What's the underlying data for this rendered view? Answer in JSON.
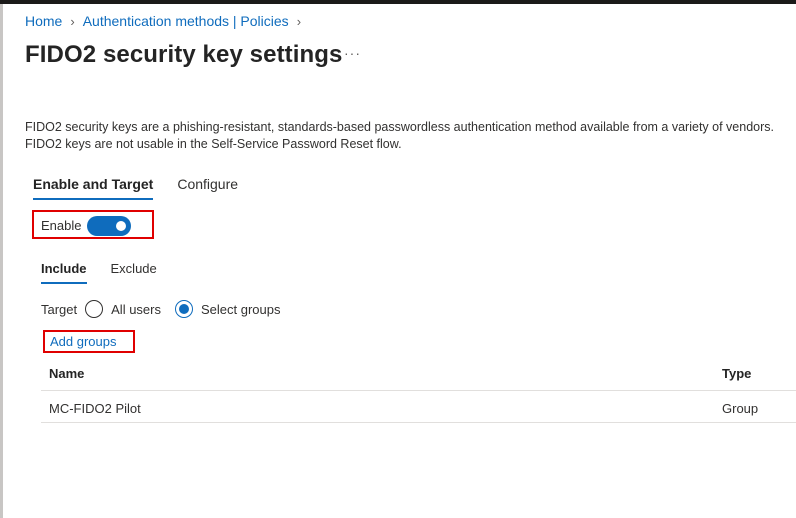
{
  "breadcrumb": {
    "items": [
      "Home",
      "Authentication methods | Policies"
    ],
    "separator": "›"
  },
  "header": {
    "title": "FIDO2 security key settings",
    "more": "···"
  },
  "description": {
    "line1": "FIDO2 security keys are a phishing-resistant, standards-based passwordless authentication method available from a variety of vendors.",
    "line2": "FIDO2 keys are not usable in the Self-Service Password Reset flow."
  },
  "tabs": [
    {
      "label": "Enable and Target",
      "active": true
    },
    {
      "label": "Configure",
      "active": false
    }
  ],
  "enable": {
    "label": "Enable",
    "state": "on"
  },
  "subtabs": [
    {
      "label": "Include",
      "active": true
    },
    {
      "label": "Exclude",
      "active": false
    }
  ],
  "target": {
    "label": "Target",
    "options": [
      {
        "label": "All users",
        "selected": false
      },
      {
        "label": "Select groups",
        "selected": true
      }
    ]
  },
  "add_groups": "Add groups",
  "table": {
    "columns": [
      "Name",
      "Type"
    ],
    "rows": [
      {
        "name": "MC-FIDO2 Pilot",
        "type": "Group"
      }
    ]
  },
  "colors": {
    "accent": "#0f6cbd",
    "highlight": "#e00000"
  }
}
